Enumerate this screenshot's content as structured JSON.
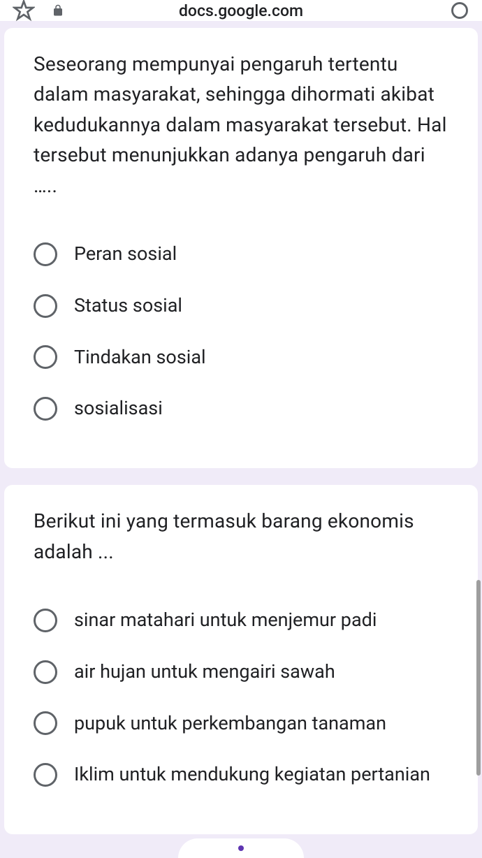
{
  "browser": {
    "url": "docs.google.com"
  },
  "questions": [
    {
      "text": "Seseorang mempunyai pengaruh tertentu dalam masyarakat, sehingga dihormati akibat kedudukannya dalam masyarakat tersebut. Hal tersebut menunjukkan adanya pengaruh dari …..",
      "options": [
        "Peran sosial",
        "Status sosial",
        "Tindakan sosial",
        "sosialisasi"
      ]
    },
    {
      "text": "Berikut ini yang termasuk barang ekonomis adalah ...",
      "options": [
        "sinar matahari untuk menjemur padi",
        "air hujan untuk mengairi sawah",
        "pupuk untuk perkembangan tanaman",
        "Iklim untuk mendukung kegiatan pertanian"
      ]
    }
  ]
}
